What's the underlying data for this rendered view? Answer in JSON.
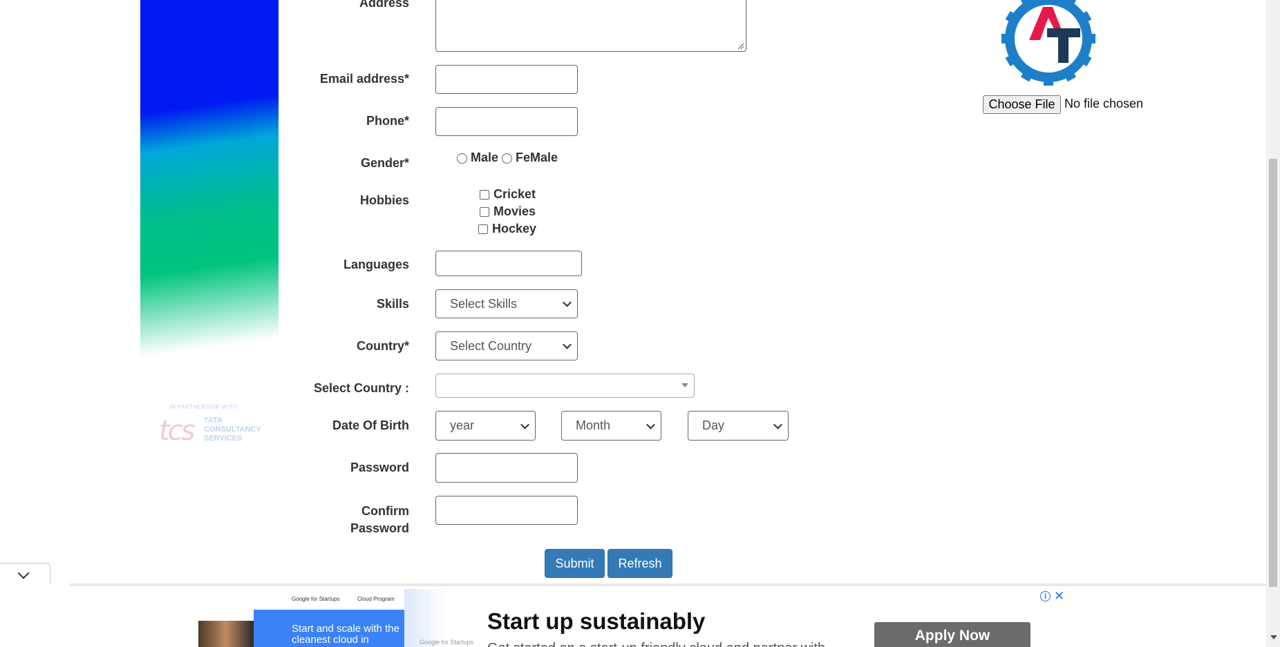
{
  "form": {
    "address_label": "Address",
    "email_label": "Email address*",
    "phone_label": "Phone*",
    "gender_label": "Gender*",
    "gender_options": [
      "Male",
      "FeMale"
    ],
    "hobbies_label": "Hobbies",
    "hobbies_options": [
      "Cricket",
      "Movies",
      "Hockey"
    ],
    "languages_label": "Languages",
    "skills_label": "Skills",
    "skills_selected": "Select Skills",
    "country_label": "Country*",
    "country_selected": "Select Country",
    "select_country_label": "Select Country :",
    "select_country_value": "",
    "dob_label": "Date Of Birth",
    "dob_year": "year",
    "dob_month": "Month",
    "dob_day": "Day",
    "password_label": "Password",
    "confirm_password_label_line1": "Confirm",
    "confirm_password_label_line2": "Password",
    "submit_label": "Submit",
    "refresh_label": "Refresh"
  },
  "photo_upload": {
    "choose_file_label": "Choose File",
    "file_status": "No file chosen"
  },
  "sidebar": {
    "partner_caption": "IN PARTNERSHIP WITH",
    "partner_logo_text": "tcs",
    "partner_name_line1": "TATA",
    "partner_name_line2": "CONSULTANCY",
    "partner_name_line3": "SERVICES"
  },
  "ad": {
    "brand_left": "Google for Startups",
    "brand_right": "Cloud Program",
    "panel_text": "Start and scale with the cleanest cloud in",
    "footer_brand": "Google for Startups",
    "headline": "Start up sustainably",
    "subtext": "Get started on a start-up friendly cloud and partner with",
    "cta": "Apply Now",
    "info_icon": "i",
    "close_icon": "✕"
  },
  "colors": {
    "button_primary": "#337ab7",
    "logo_blue": "#1e7fc9",
    "logo_red": "#e6194b",
    "logo_navy": "#1b3a5a"
  }
}
